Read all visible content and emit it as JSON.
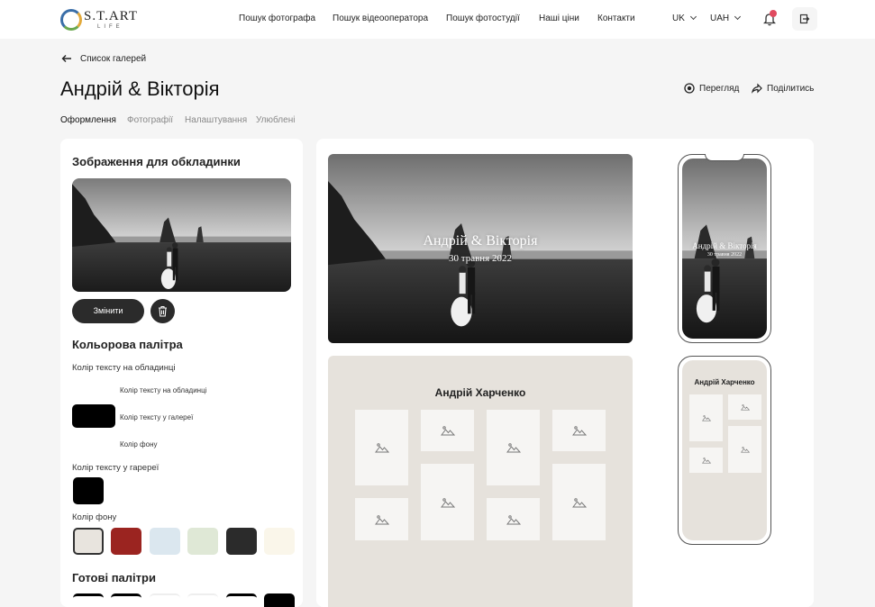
{
  "header": {
    "logo_text": "S.T.ART",
    "logo_sub": "LIFE",
    "nav": [
      "Пошук фотографа",
      "Пошук відеооператора",
      "Пошук фотостудії",
      "Наші ціни",
      "Контакти"
    ],
    "language": "UK",
    "currency": "UAH"
  },
  "breadcrumb": {
    "back_label": "Список галерей"
  },
  "page": {
    "title": "Андрій & Вікторія",
    "actions": {
      "preview": "Перегляд",
      "share": "Поділитись"
    },
    "tabs": [
      "Оформлення",
      "Фотографії",
      "Налаштування",
      "Улюблені"
    ]
  },
  "left": {
    "cover_heading": "Зображення для обкладинки",
    "change_label": "Змінити",
    "palette_heading": "Кольорова палітра",
    "cover_text_label": "Колір тексту на обладинці",
    "options": [
      "Колір тексту на обладинці",
      "Колір тексту у галереї",
      "Колір фону"
    ],
    "gallery_text_label": "Колір тексту у гаререї",
    "bg_label": "Колір фону",
    "ready_heading": "Готові палітри"
  },
  "preview": {
    "cover_title": "Андрій & Вікторія",
    "cover_date": "30 травня 2022",
    "gallery_title": "Андрій Харченко",
    "mobile_cover_title": "Андрій & Вікторія",
    "mobile_cover_date": "30 травня 2022",
    "mobile_gallery_title": "Андрій Харченко"
  },
  "colors": {
    "bg_swatches": [
      "#e8e4de",
      "#9b2420",
      "#dbe7ef",
      "#dfe8d6",
      "#2b2b2b",
      "#faf6ea"
    ],
    "gallery_bg": "#e6e2dc",
    "notification_dot": "#e04a5f"
  },
  "icons": [
    "arrow-left-icon",
    "bell-icon",
    "logout-icon",
    "eye-icon",
    "share-icon",
    "trash-icon",
    "image-placeholder-icon",
    "chevron-down-icon"
  ]
}
